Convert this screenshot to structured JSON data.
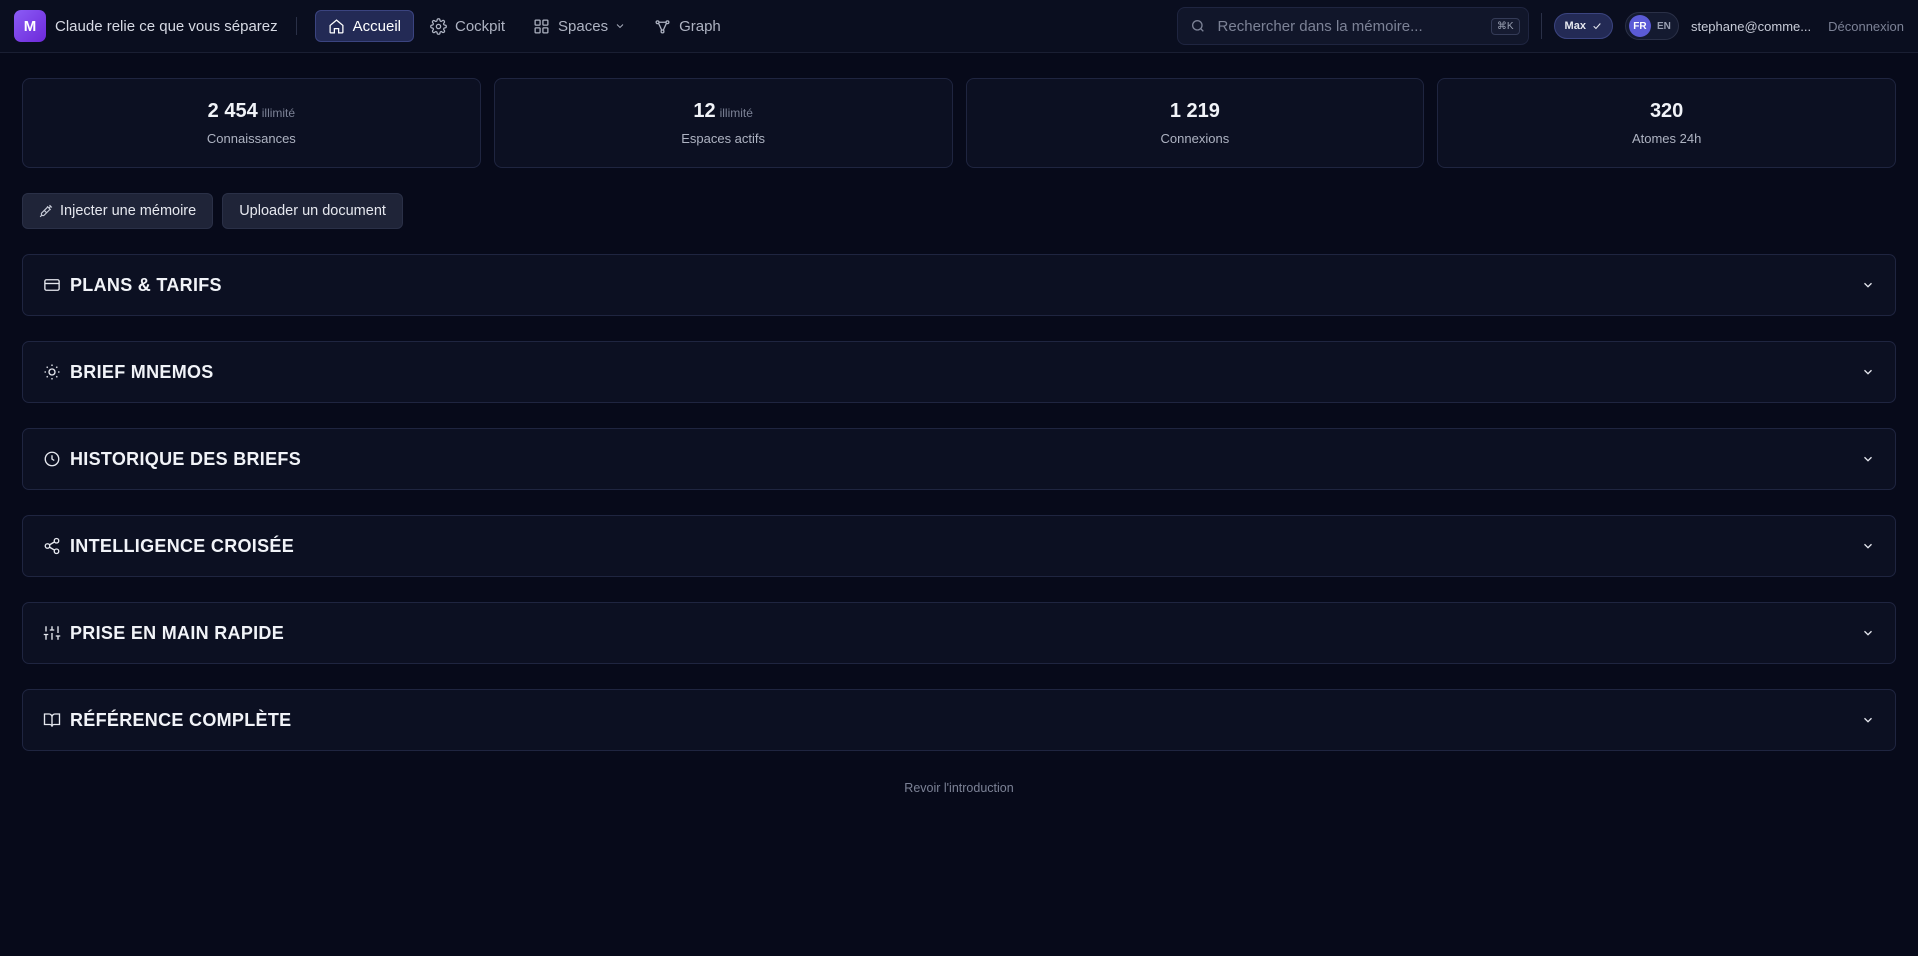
{
  "app": {
    "logo_letter": "M",
    "title": "Claude relie ce que vous séparez"
  },
  "nav": {
    "items": [
      {
        "label": "Accueil",
        "icon": "home-icon",
        "active": true
      },
      {
        "label": "Cockpit",
        "icon": "gear-icon",
        "active": false
      },
      {
        "label": "Spaces",
        "icon": "grid-icon",
        "active": false,
        "has_dropdown": true
      },
      {
        "label": "Graph",
        "icon": "graph-icon",
        "active": false
      }
    ]
  },
  "search": {
    "placeholder": "Rechercher dans la mémoire...",
    "shortcut": "⌘K"
  },
  "account": {
    "plan": "Max",
    "languages": [
      "FR",
      "EN"
    ],
    "active_language": "FR",
    "email": "stephane@comme...",
    "logout_label": "Déconnexion"
  },
  "stats": [
    {
      "value": "2 454",
      "suffix": "illimité",
      "label": "Connaissances"
    },
    {
      "value": "12",
      "suffix": "illimité",
      "label": "Espaces actifs"
    },
    {
      "value": "1 219",
      "suffix": "",
      "label": "Connexions"
    },
    {
      "value": "320",
      "suffix": "",
      "label": "Atomes 24h"
    }
  ],
  "actions": {
    "inject_label": "Injecter une mémoire",
    "upload_label": "Uploader un document"
  },
  "sections": [
    {
      "title": "PLANS & TARIFS",
      "icon": "credit-card-icon"
    },
    {
      "title": "BRIEF MNEMOS",
      "icon": "sun-icon"
    },
    {
      "title": "HISTORIQUE DES BRIEFS",
      "icon": "clock-icon"
    },
    {
      "title": "INTELLIGENCE CROISÉE",
      "icon": "share-icon"
    },
    {
      "title": "PRISE EN MAIN RAPIDE",
      "icon": "sliders-icon"
    },
    {
      "title": "RÉFÉRENCE COMPLÈTE",
      "icon": "book-open-icon"
    }
  ],
  "footer": {
    "intro_link": "Revoir l'introduction"
  },
  "colors": {
    "background": "#070a1a",
    "accent": "#8b5cf6",
    "active_nav": "#232a55"
  }
}
